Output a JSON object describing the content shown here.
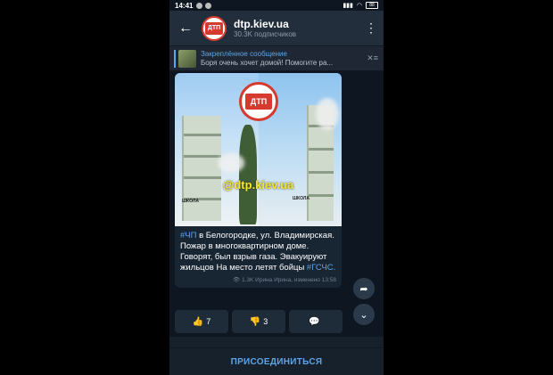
{
  "status_bar": {
    "time": "14:41",
    "battery": "88"
  },
  "header": {
    "back_icon": "arrow-left-icon",
    "channel_name": "dtp.kiev.ua",
    "subscribers": "30.3K подписчиков",
    "avatar_text": "ДТП",
    "menu_icon": "more-vertical-icon"
  },
  "pinned": {
    "title": "Закреплённое сообщение",
    "text": "Боря очень хочет домой! Помогите ра..."
  },
  "post": {
    "watermark_logo": "ДТП",
    "watermark_handle": "@dtp.kiev.ua",
    "sign_text": "ШКОЛА",
    "text_hashtag_1": "#ЧП",
    "text_body": " в Белогородке, ул. Владимирская. Пожар в многоквартирном доме. Говорят, был взрыв газа. Эвакуируют жильцов На место летят бойцы",
    "text_hashtag_2": "#ГСЧС.",
    "views": "1.3K",
    "author_info": "Ирина Ирина, изменено 13:58"
  },
  "reactions": [
    {
      "icon": "thumbs-up-icon",
      "count": "7"
    },
    {
      "icon": "thumbs-down-icon",
      "count": "3"
    },
    {
      "icon": "comment-icon",
      "count": ""
    }
  ],
  "join_button": "ПРИСОЕДИНИТЬСЯ",
  "colors": {
    "accent": "#5ea4e6",
    "background": "#0e1621",
    "header": "#232e3c",
    "bubble": "#182533"
  }
}
